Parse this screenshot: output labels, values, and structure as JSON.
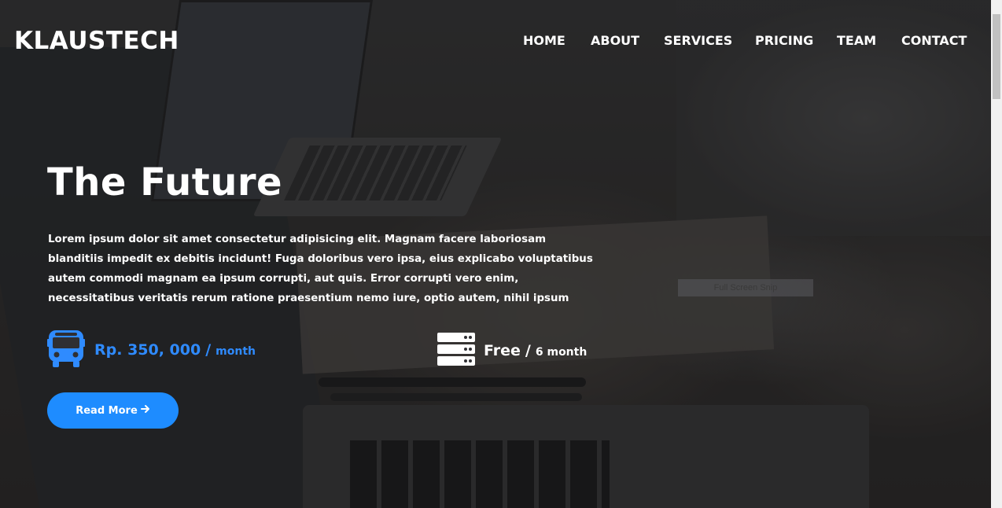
{
  "header": {
    "logo": "KLAUSTECH",
    "nav": [
      {
        "label": "HOME"
      },
      {
        "label": "ABOUT"
      },
      {
        "label": "SERVICES"
      },
      {
        "label": "PRICING"
      },
      {
        "label": "TEAM"
      },
      {
        "label": "CONTACT"
      }
    ]
  },
  "hero": {
    "title": "The Future",
    "description": "Lorem ipsum dolor sit amet consectetur adipisicing elit. Magnam facere laboriosam blanditiis impedit ex debitis incidunt! Fuga doloribus vero ipsa, eius explicabo voluptatibus autem commodi magnam ea ipsum corrupti, aut quis. Error corrupti vero enim, necessitatibus veritatis rerum ratione praesentium nemo iure, optio autem, nihil ipsum",
    "background_text": "Full Screen Snip",
    "price_primary": {
      "icon": "bus-icon",
      "amount": "Rp. 350, 000",
      "slash": "/",
      "unit": "month"
    },
    "price_secondary": {
      "icon": "server-icon",
      "amount": "Free",
      "slash": "/",
      "unit": "6 month"
    },
    "cta_label": "Read More",
    "cta_icon": "arrow-right-icon"
  },
  "colors": {
    "accent": "#1e8cff",
    "price_accent": "#2f8bff",
    "text": "#ffffff"
  }
}
